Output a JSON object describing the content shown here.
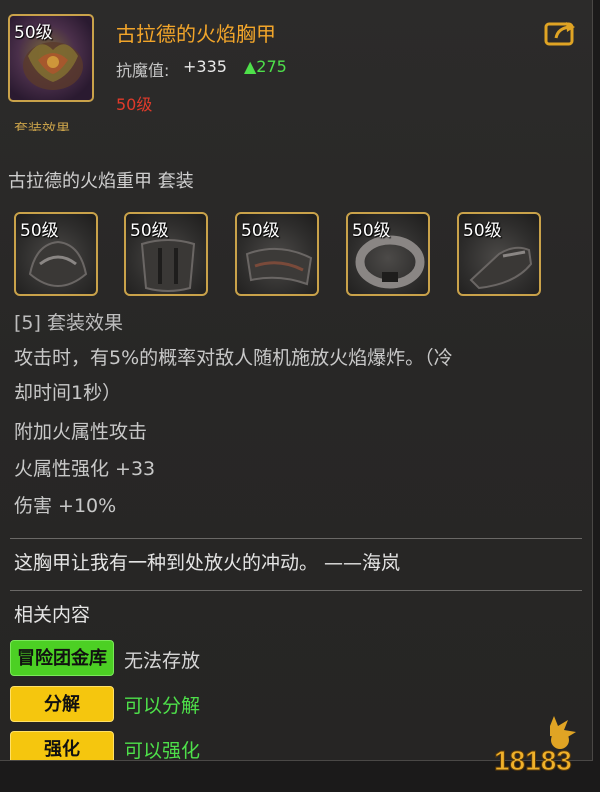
{
  "item": {
    "level_badge": "50级",
    "name": "古拉德的火焰胸甲",
    "stat_label": "抗魔值:",
    "stat_value": "+335",
    "stat_bonus": "▲275",
    "required_level": "50级",
    "cut_text": "套装效果"
  },
  "set": {
    "name": "古拉德的火焰重甲  套装",
    "pieces": [
      {
        "level": "50级"
      },
      {
        "level": "50级"
      },
      {
        "level": "50级"
      },
      {
        "level": "50级"
      },
      {
        "level": "50级"
      }
    ],
    "effect_title": "[5] 套装效果",
    "lines": [
      "攻击时，有5%的概率对敌人随机施放火焰爆炸。（冷",
      "却时间1秒）",
      "附加火属性攻击",
      "火属性强化 +33",
      "伤害 +10%"
    ]
  },
  "flavor_text": "这胸甲让我有一种到处放火的冲动。 ——海岚",
  "related": {
    "title": "相关内容",
    "tags": [
      {
        "label": "冒险团金库",
        "value": "无法存放"
      },
      {
        "label": "分解",
        "value": "可以分解"
      },
      {
        "label": "强化",
        "value": "可以强化"
      }
    ]
  },
  "watermark": "18183",
  "colors": {
    "item_name": "#f2a52a",
    "bonus_green": "#4ee04a",
    "required_red": "#e03a2a",
    "frame_gold": "#c9a24a",
    "tag_green": "#4cd024",
    "tag_yellow": "#f5c60e"
  },
  "icons": [
    "share-icon",
    "breastplate-icon",
    "armor-piece-icon"
  ]
}
